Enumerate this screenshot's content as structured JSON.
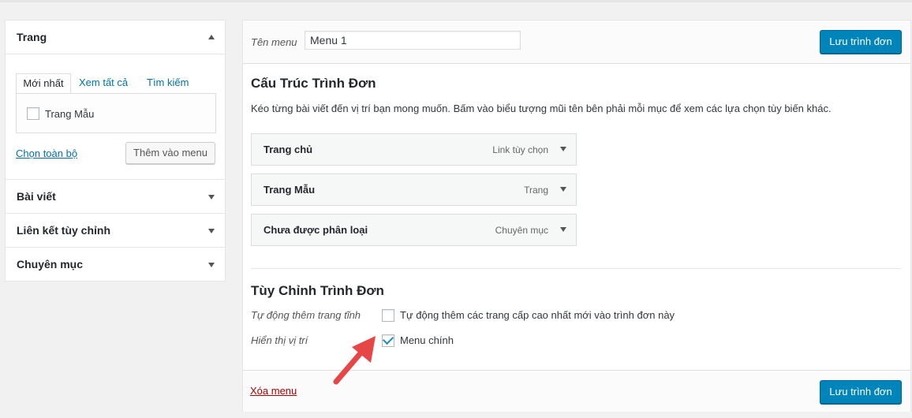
{
  "left": {
    "pages": {
      "title": "Trang",
      "tabs": [
        "Mới nhất",
        "Xem tất cả",
        "Tìm kiếm"
      ],
      "items": [
        {
          "label": "Trang Mẫu",
          "checked": false
        }
      ],
      "select_all": "Chọn toàn bộ",
      "add_button": "Thêm vào menu"
    },
    "sections": [
      "Bài viết",
      "Liên kết tùy chỉnh",
      "Chuyên mục"
    ]
  },
  "editor": {
    "name_label": "Tên menu",
    "name_value": "Menu 1",
    "save_label": "Lưu trình đơn",
    "structure": {
      "title": "Cấu Trúc Trình Đơn",
      "description": "Kéo từng bài viết đến vị trí bạn mong muốn. Bấm vào biểu tượng mũi tên bên phải mỗi mục để xem các lựa chọn tùy biến khác.",
      "items": [
        {
          "name": "Trang chủ",
          "type": "Link tùy chọn"
        },
        {
          "name": "Trang Mẫu",
          "type": "Trang"
        },
        {
          "name": "Chưa được phân loại",
          "type": "Chuyên mục"
        }
      ]
    },
    "settings": {
      "title": "Tùy Chỉnh Trình Đơn",
      "auto_add_label": "Tự động thêm trang tĩnh",
      "auto_add_text": "Tự động thêm các trang cấp cao nhất mới vào trình đơn này",
      "auto_add_checked": false,
      "location_label": "Hiển thị vị trí",
      "location_text": "Menu chính",
      "location_checked": true
    },
    "delete_label": "Xóa menu"
  },
  "colors": {
    "primary": "#0085ba",
    "link": "#0073aa",
    "delete": "#a00",
    "arrow": "#e64646"
  }
}
